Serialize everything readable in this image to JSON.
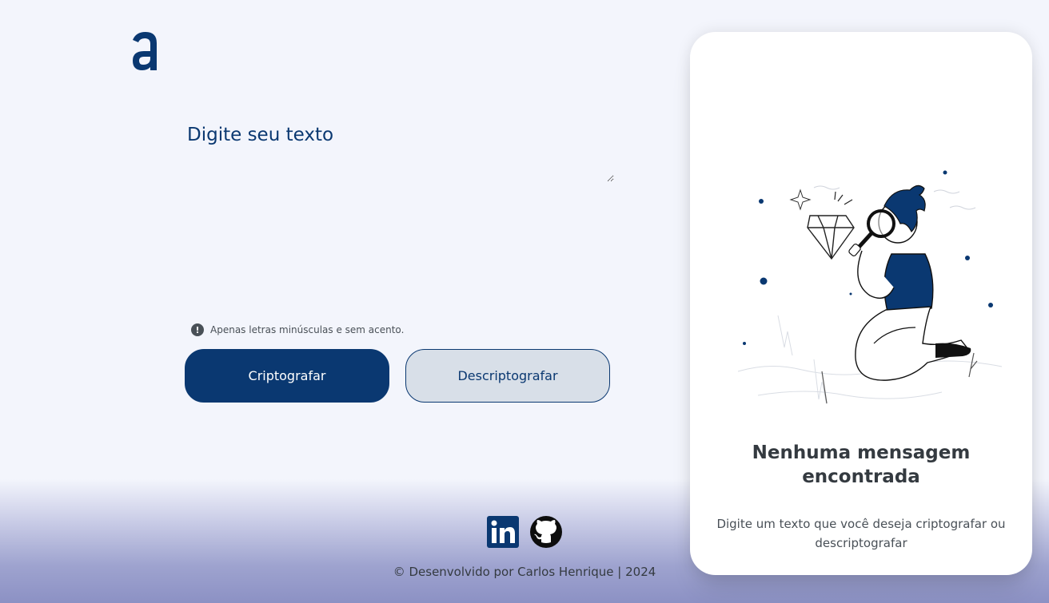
{
  "brand": {
    "logo_icon": "alura-a-logo-icon",
    "accent_color": "#0a3871"
  },
  "input": {
    "placeholder": "Digite seu texto",
    "value": ""
  },
  "hint": {
    "icon": "exclamation-circle-icon",
    "text": "Apenas letras minúsculas e sem acento."
  },
  "buttons": {
    "encrypt_label": "Criptografar",
    "decrypt_label": "Descriptografar"
  },
  "output_panel": {
    "illustration": "person-with-magnifying-glass-and-diamond-illustration",
    "title": "Nenhuma mensagem encontrada",
    "description": "Digite um texto que você deseja criptografar ou descriptografar"
  },
  "footer": {
    "social": [
      {
        "icon": "linkedin-icon"
      },
      {
        "icon": "github-icon"
      }
    ],
    "copyright": "© Desenvolvido por Carlos Henrique | 2024"
  }
}
